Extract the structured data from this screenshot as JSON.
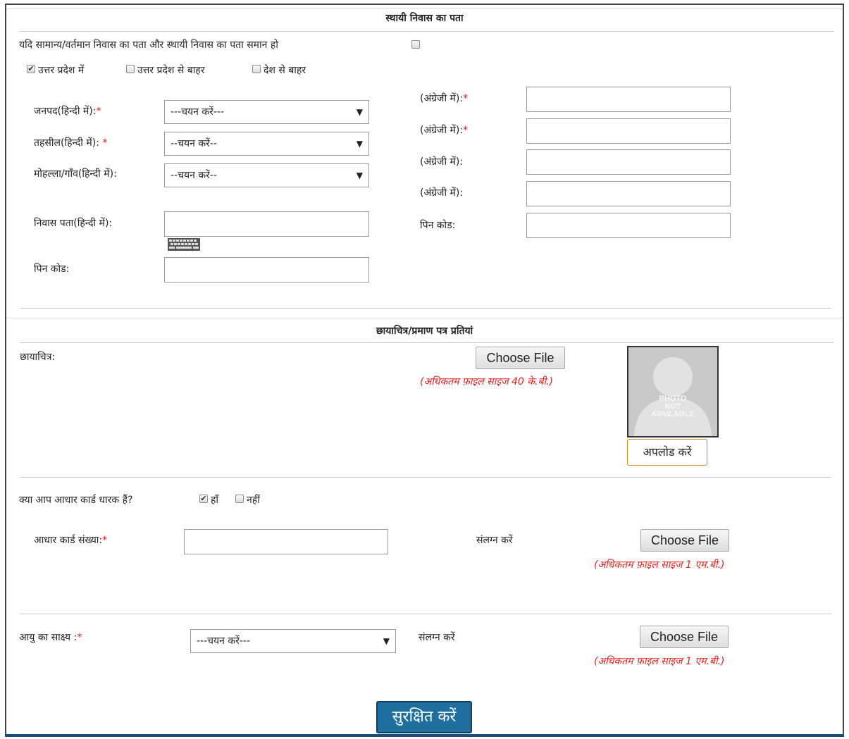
{
  "permanent_address": {
    "section_title": "स्थायी निवास का पता",
    "same_as_current_label": "यदि सामान्य/वर्तमान निवास का पता और स्थायी निवास का पता समान हो",
    "location_options": [
      {
        "label": "उत्तर प्रदेश में",
        "checked": true
      },
      {
        "label": "उत्तर प्रदेश से बाहर",
        "checked": false
      },
      {
        "label": "देश से बाहर",
        "checked": false
      }
    ],
    "district_label": "जनपद(हिन्दी में):",
    "district_value": "---चयन करें---",
    "tehsil_label": "तहसील(हिन्दी में): ",
    "tehsil_value": "--चयन करें--",
    "mohalla_label": "मोहल्ला/गाँव(हिन्दी में):",
    "mohalla_value": "--चयन करें--",
    "address_label": "निवास पता(हिन्दी में):",
    "pin_label": "पिन कोड:",
    "english_label": "(अंग्रेजी में):",
    "english_pin_label": "पिन कोड:",
    "required_mark": "*"
  },
  "photo_section": {
    "section_title": "छायाचित्र/प्रमाण पत्र प्रतियां",
    "photo_label": "छायाचित्र:",
    "choose_file_label": "Choose File",
    "photo_hint": "(अधिकतम फ़ाइल साइज 40 के.बी.)",
    "placeholder_line1": "PHOTO",
    "placeholder_line2": "NOT",
    "placeholder_line3": "AVAILABLE",
    "upload_label": "अपलोड करें"
  },
  "aadhaar_section": {
    "question_label": "क्या आप आधार कार्ड धारक हैं?",
    "yes_label": "हाँ",
    "yes_checked": true,
    "no_label": "नहीं",
    "no_checked": false,
    "number_label": "आधार कार्ड संख्या:",
    "attach_label": "संलग्न करें",
    "choose_file_label": "Choose File",
    "hint": "(अधिकतम फ़ाइल साइज 1 एम.बी.)"
  },
  "age_section": {
    "proof_label": "आयु का साक्ष्य :",
    "proof_value": "---चयन करें---",
    "attach_label": "संलग्न करें",
    "choose_file_label": "Choose File",
    "hint": "(अधिकतम फ़ाइल साइज 1 एम.बी.)"
  },
  "save_label": "सुरक्षित करें",
  "colors": {
    "required": "#e02020",
    "save_button": "#1f6f9e",
    "upload_border": "#d08a2a"
  }
}
